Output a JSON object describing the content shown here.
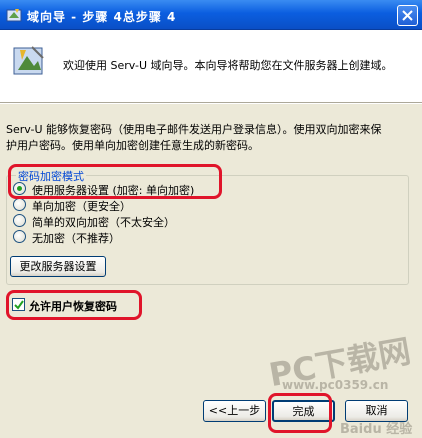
{
  "window": {
    "title": "域向导 - 步骤 4总步骤 4",
    "close_icon": "close-icon"
  },
  "header": {
    "welcome_text": "欢迎使用 Serv-U 域向导。本向导将帮助您在文件服务器上创建域。"
  },
  "body": {
    "description_line1": "Serv-U 能够恢复密码（使用电子邮件发送用户登录信息）。使用双向加密来保",
    "description_line2": "护用户密码。使用单向加密创建任意生成的新密码。"
  },
  "encryption_group": {
    "legend": "密码加密模式",
    "options": [
      {
        "label": "使用服务器设置 (加密: 单向加密)",
        "checked": true
      },
      {
        "label": "单向加密（更安全）",
        "checked": false
      },
      {
        "label": "简单的双向加密（不太安全）",
        "checked": false
      },
      {
        "label": "无加密（不推荐）",
        "checked": false
      }
    ],
    "change_server_settings_label": "更改服务器设置"
  },
  "allow_recovery": {
    "label": "允许用户恢复密码",
    "checked": true
  },
  "footer": {
    "back_label": "<<上一步",
    "finish_label": "完成",
    "cancel_label": "取消"
  },
  "watermark": {
    "brand": "PC下载网",
    "site": "www.pc0359.cn",
    "bottom": "Baidu 经验"
  },
  "colors": {
    "title_bar": "#0b5ee0",
    "dialog_bg": "#ece9d8",
    "legend_text": "#0046d5",
    "highlight_red": "#e0142a"
  }
}
